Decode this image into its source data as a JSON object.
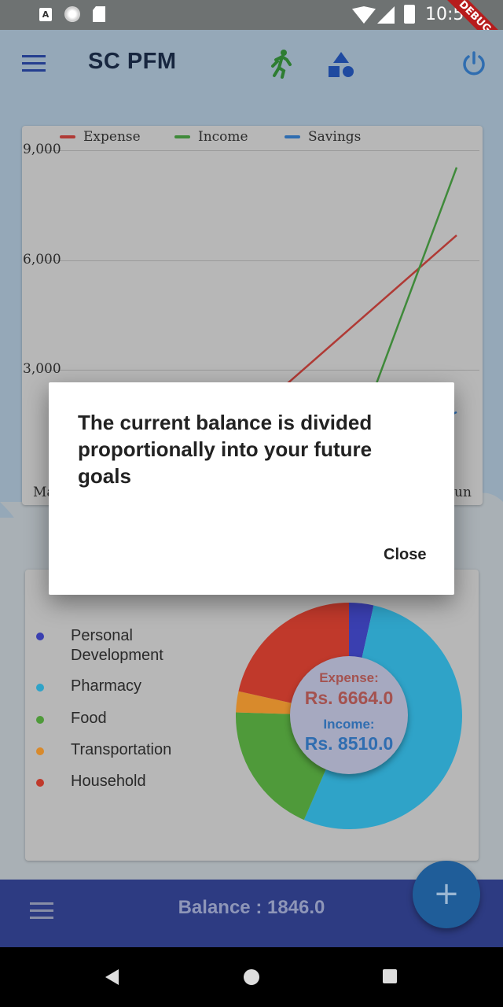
{
  "status_bar": {
    "time": "10:56",
    "debug_banner": "DEBUG",
    "left_icon_letter": "A"
  },
  "app_bar": {
    "title": "SC PFM",
    "icons": [
      "menu-icon",
      "running-icon",
      "shapes-icon",
      "power-icon"
    ]
  },
  "line_chart": {
    "legend": [
      "Expense",
      "Income",
      "Savings"
    ],
    "y_ticks": [
      "9,000",
      "6,000",
      "3,000"
    ],
    "x_tick_left": "Ma",
    "x_tick_right": "un"
  },
  "pie_card": {
    "legend": [
      {
        "label": "Personal\nDevelopment",
        "color": "#3a3fb0"
      },
      {
        "label": "Pharmacy",
        "color": "#2fa3c8"
      },
      {
        "label": "Food",
        "color": "#4f9a3a"
      },
      {
        "label": "Transportation",
        "color": "#d88a2c"
      },
      {
        "label": "Household",
        "color": "#c0392b"
      }
    ],
    "center": {
      "expense_label": "Expense:",
      "expense_value": "Rs. 6664.0",
      "income_label": "Income:",
      "income_value": "Rs. 8510.0"
    }
  },
  "bottom_bar": {
    "balance": "Balance : 1846.0",
    "fab_label": "+"
  },
  "dialog": {
    "message": "The current balance is divided proportionally into your future goals",
    "close_label": "Close"
  },
  "colors": {
    "expense": "#b03a35",
    "income": "#3f8a3a",
    "savings": "#2f6db0",
    "primary": "#2d3b82"
  },
  "chart_data": {
    "type": "line",
    "title": "",
    "series": [
      {
        "name": "Expense",
        "x": [
          "Ma",
          "Jun"
        ],
        "values": [
          0,
          6664
        ]
      },
      {
        "name": "Income",
        "x": [
          "Ma",
          "Jun"
        ],
        "values": [
          0,
          8510
        ]
      },
      {
        "name": "Savings",
        "x": [
          "Ma",
          "Jun"
        ],
        "values": [
          0,
          1846
        ]
      }
    ],
    "ylim": [
      0,
      9000
    ],
    "y_ticks": [
      3000,
      6000,
      9000
    ],
    "legend_position": "top"
  },
  "pie_data": {
    "type": "pie",
    "categories": [
      "Personal Development",
      "Pharmacy",
      "Food",
      "Transportation",
      "Household"
    ],
    "values": [
      3.5,
      53,
      19,
      3,
      21.5
    ]
  }
}
